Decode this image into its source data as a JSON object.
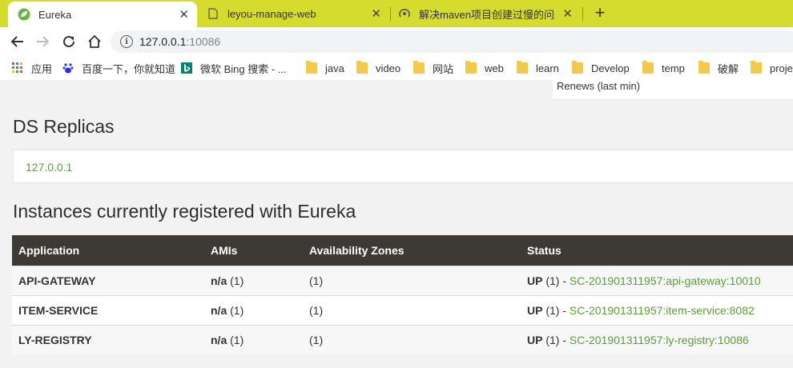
{
  "colors": {
    "tabbar": "#d6dc2e",
    "table_header": "#3d3934",
    "link": "#5a9e3a"
  },
  "tabs": [
    {
      "label": "Eureka",
      "icon": "spring-leaf-icon",
      "close": "✕"
    },
    {
      "label": "leyou-manage-web",
      "icon": "page-icon",
      "close": "✕"
    },
    {
      "label": "解决maven项目创建过慢的问题",
      "icon": "loading-icon",
      "close": "✕"
    }
  ],
  "new_tab": "+",
  "address": {
    "host": "127.0.0.1",
    "port": ":10086"
  },
  "bookmarks": [
    {
      "label": "应用",
      "icon": "apps-icon"
    },
    {
      "label": "百度一下，你就知道",
      "icon": "baidu-icon"
    },
    {
      "label": "微软 Bing 搜索 - ...",
      "icon": "bing-icon"
    },
    {
      "label": "java",
      "icon": "folder-icon"
    },
    {
      "label": "video",
      "icon": "folder-icon"
    },
    {
      "label": "网站",
      "icon": "folder-icon"
    },
    {
      "label": "web",
      "icon": "folder-icon"
    },
    {
      "label": "learn",
      "icon": "folder-icon"
    },
    {
      "label": "Develop",
      "icon": "folder-icon"
    },
    {
      "label": "temp",
      "icon": "folder-icon"
    },
    {
      "label": "破解",
      "icon": "folder-icon"
    },
    {
      "label": "proje",
      "icon": "folder-icon"
    }
  ],
  "renews": "Renews (last min)",
  "ds_replicas": {
    "title": "DS Replicas",
    "link": "127.0.0.1"
  },
  "instances": {
    "title": "Instances currently registered with Eureka",
    "headers": [
      "Application",
      "AMIs",
      "Availability Zones",
      "Status"
    ],
    "rows": [
      {
        "app": "API-GATEWAY",
        "ami_bold": "n/a",
        "ami_count": "(1)",
        "zones": "(1)",
        "status": "UP",
        "status_count": "(1) -",
        "instance": "SC-201901311957:api-gateway:10010"
      },
      {
        "app": "ITEM-SERVICE",
        "ami_bold": "n/a",
        "ami_count": "(1)",
        "zones": "(1)",
        "status": "UP",
        "status_count": "(1) -",
        "instance": "SC-201901311957:item-service:8082"
      },
      {
        "app": "LY-REGISTRY",
        "ami_bold": "n/a",
        "ami_count": "(1)",
        "zones": "(1)",
        "status": "UP",
        "status_count": "(1) -",
        "instance": "SC-201901311957:ly-registry:10086"
      }
    ]
  }
}
